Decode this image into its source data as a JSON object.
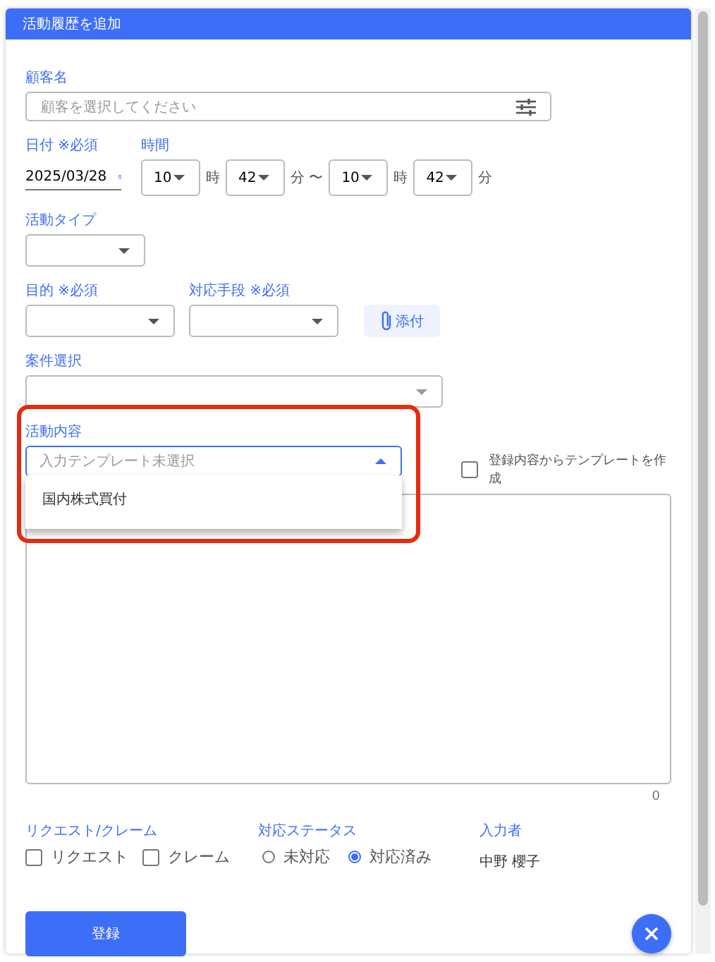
{
  "dialog": {
    "title": "活動履歴を追加"
  },
  "customer": {
    "label": "顧客名",
    "placeholder": "顧客を選択してください"
  },
  "date": {
    "label": "日付 ※必須",
    "value": "2025/03/28"
  },
  "time": {
    "label": "時間",
    "parts": [
      {
        "kind": "select",
        "value": "10"
      },
      {
        "kind": "unit",
        "text": "時"
      },
      {
        "kind": "select",
        "value": "42"
      },
      {
        "kind": "unit",
        "text": "分 〜"
      },
      {
        "kind": "select",
        "value": "10"
      },
      {
        "kind": "unit",
        "text": "時"
      },
      {
        "kind": "select",
        "value": "42"
      },
      {
        "kind": "unit",
        "text": "分"
      }
    ]
  },
  "activity_type": {
    "label": "活動タイプ"
  },
  "purpose": {
    "label": "目的 ※必須"
  },
  "method": {
    "label": "対応手段 ※必須"
  },
  "attach_button": {
    "label": "添付"
  },
  "project": {
    "label": "案件選択"
  },
  "content": {
    "label": "活動内容",
    "placeholder": "入力テンプレート未選択",
    "expanded": true,
    "options": [
      "国内株式買付"
    ]
  },
  "template_checkbox": {
    "label": "登録内容からテンプレートを作成",
    "checked": false
  },
  "textarea": {
    "counter": "0"
  },
  "request": {
    "label": "リクエスト/クレーム",
    "options": [
      {
        "label": "リクエスト",
        "checked": false
      },
      {
        "label": "クレーム",
        "checked": false
      }
    ]
  },
  "status": {
    "label": "対応ステータス",
    "options": [
      {
        "label": "未対応",
        "selected": false
      },
      {
        "label": "対応済み",
        "selected": true
      }
    ]
  },
  "author": {
    "label": "入力者",
    "value": "中野 櫻子"
  },
  "submit": {
    "label": "登録"
  }
}
